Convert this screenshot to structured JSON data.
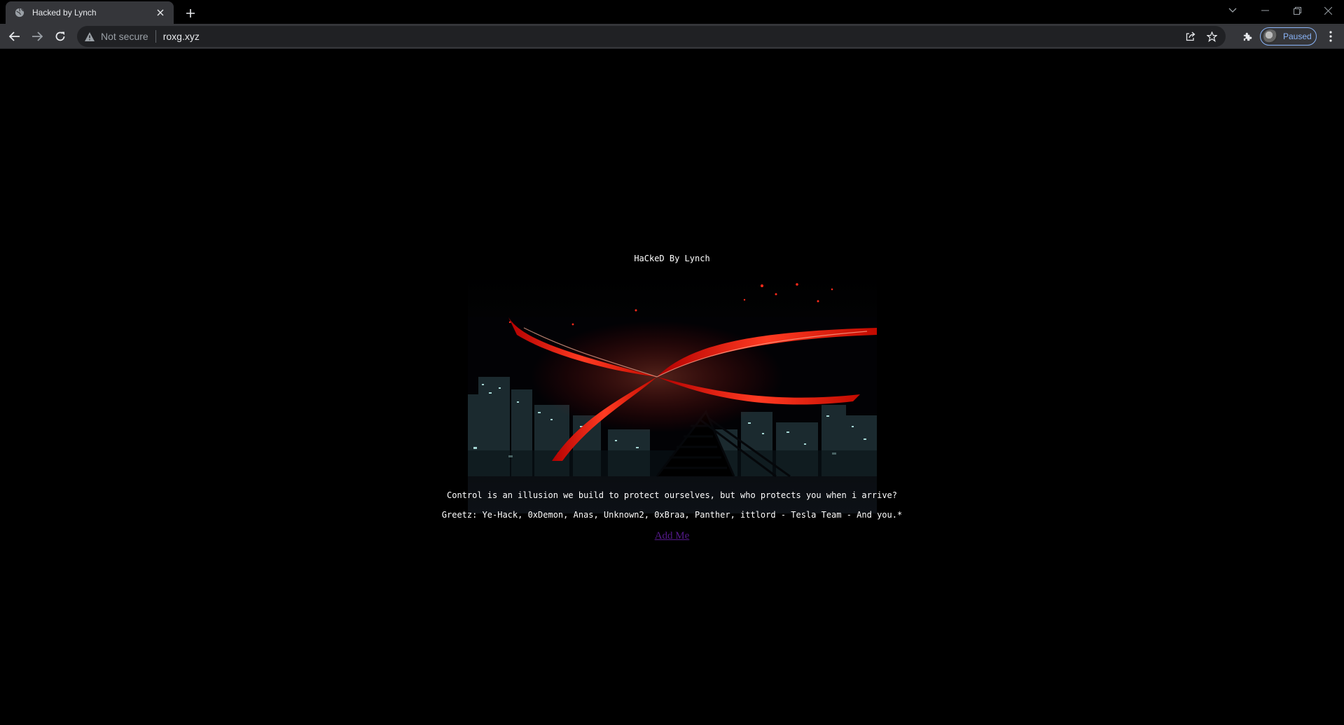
{
  "browser": {
    "tab": {
      "title": "Hacked by Lynch",
      "favicon": "globe-icon"
    },
    "address_bar": {
      "security_label": "Not secure",
      "url": "roxg.xyz"
    },
    "profile": {
      "status": "Paused"
    }
  },
  "page": {
    "heading": "HaCkeD By Lynch",
    "image_label": "anime-red-wings-city-night-icon",
    "quote": "Control is an illusion we build to protect ourselves, but who protects you when i arrive?",
    "greetz": "Greetz: Ye-Hack, 0xDemon, Anas, Unknown2, 0xBraa, Panther, ittlord - Tesla Team - And you.*",
    "link": "Add Me"
  },
  "colors": {
    "background": "#000000",
    "link": "#551a8b",
    "accent_red": "#ff2a1a"
  }
}
